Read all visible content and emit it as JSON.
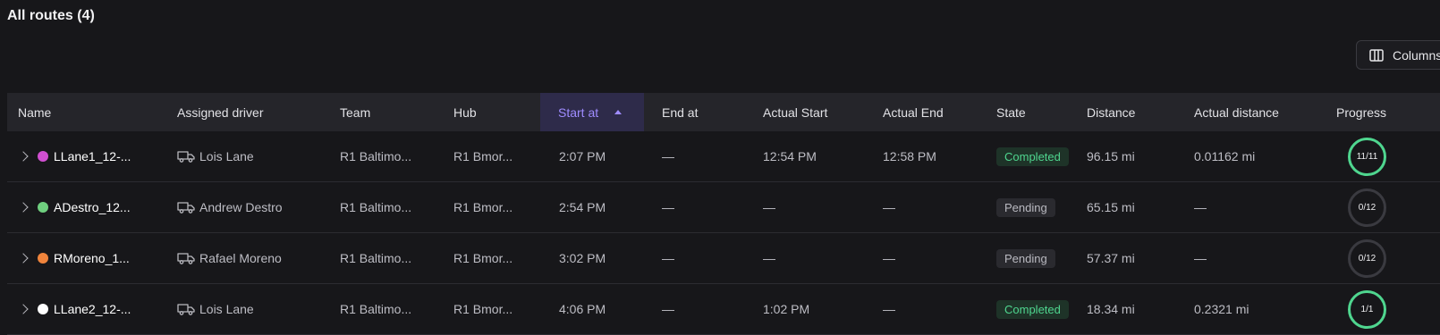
{
  "page": {
    "title": "All routes (4)"
  },
  "toolbar": {
    "columns_label": "Columns"
  },
  "table": {
    "columns": {
      "name": "Name",
      "driver": "Assigned driver",
      "team": "Team",
      "hub": "Hub",
      "start_at": "Start at",
      "end_at": "End at",
      "actual_start": "Actual Start",
      "actual_end": "Actual End",
      "state": "State",
      "distance": "Distance",
      "actual_distance": "Actual distance",
      "progress": "Progress"
    },
    "sorted_column": "start_at",
    "sort_direction": "ascending",
    "rows": [
      {
        "name": "LLane1_12-...",
        "dot_color": "#d14fd1",
        "driver": "Lois Lane",
        "team": "R1 Baltimo...",
        "hub": "R1 Bmor...",
        "start_at": "2:07 PM",
        "end_at": "—",
        "actual_start": "12:54 PM",
        "actual_end": "12:58 PM",
        "state": "Completed",
        "distance": "96.15 mi",
        "actual_distance": "0.01162 mi",
        "progress": "11/11",
        "progress_complete": true
      },
      {
        "name": "ADestro_12...",
        "dot_color": "#6fcf7f",
        "driver": "Andrew Destro",
        "team": "R1 Baltimo...",
        "hub": "R1 Bmor...",
        "start_at": "2:54 PM",
        "end_at": "—",
        "actual_start": "—",
        "actual_end": "—",
        "state": "Pending",
        "distance": "65.15 mi",
        "actual_distance": "—",
        "progress": "0/12",
        "progress_complete": false
      },
      {
        "name": "RMoreno_1...",
        "dot_color": "#f0843c",
        "driver": "Rafael Moreno",
        "team": "R1 Baltimo...",
        "hub": "R1 Bmor...",
        "start_at": "3:02 PM",
        "end_at": "—",
        "actual_start": "—",
        "actual_end": "—",
        "state": "Pending",
        "distance": "57.37 mi",
        "actual_distance": "—",
        "progress": "0/12",
        "progress_complete": false
      },
      {
        "name": "LLane2_12-...",
        "dot_color": "#ffffff",
        "driver": "Lois Lane",
        "team": "R1 Baltimo...",
        "hub": "R1 Bmor...",
        "start_at": "4:06 PM",
        "end_at": "—",
        "actual_start": "1:02 PM",
        "actual_end": "—",
        "state": "Completed",
        "distance": "18.34 mi",
        "actual_distance": "0.2321 mi",
        "progress": "1/1",
        "progress_complete": true
      }
    ]
  },
  "colors": {
    "background": "#17171a",
    "header_bg": "#25252a",
    "accent": "#9f8cff",
    "completed": "#4fd68f",
    "pending_ring": "#3a3a40"
  }
}
